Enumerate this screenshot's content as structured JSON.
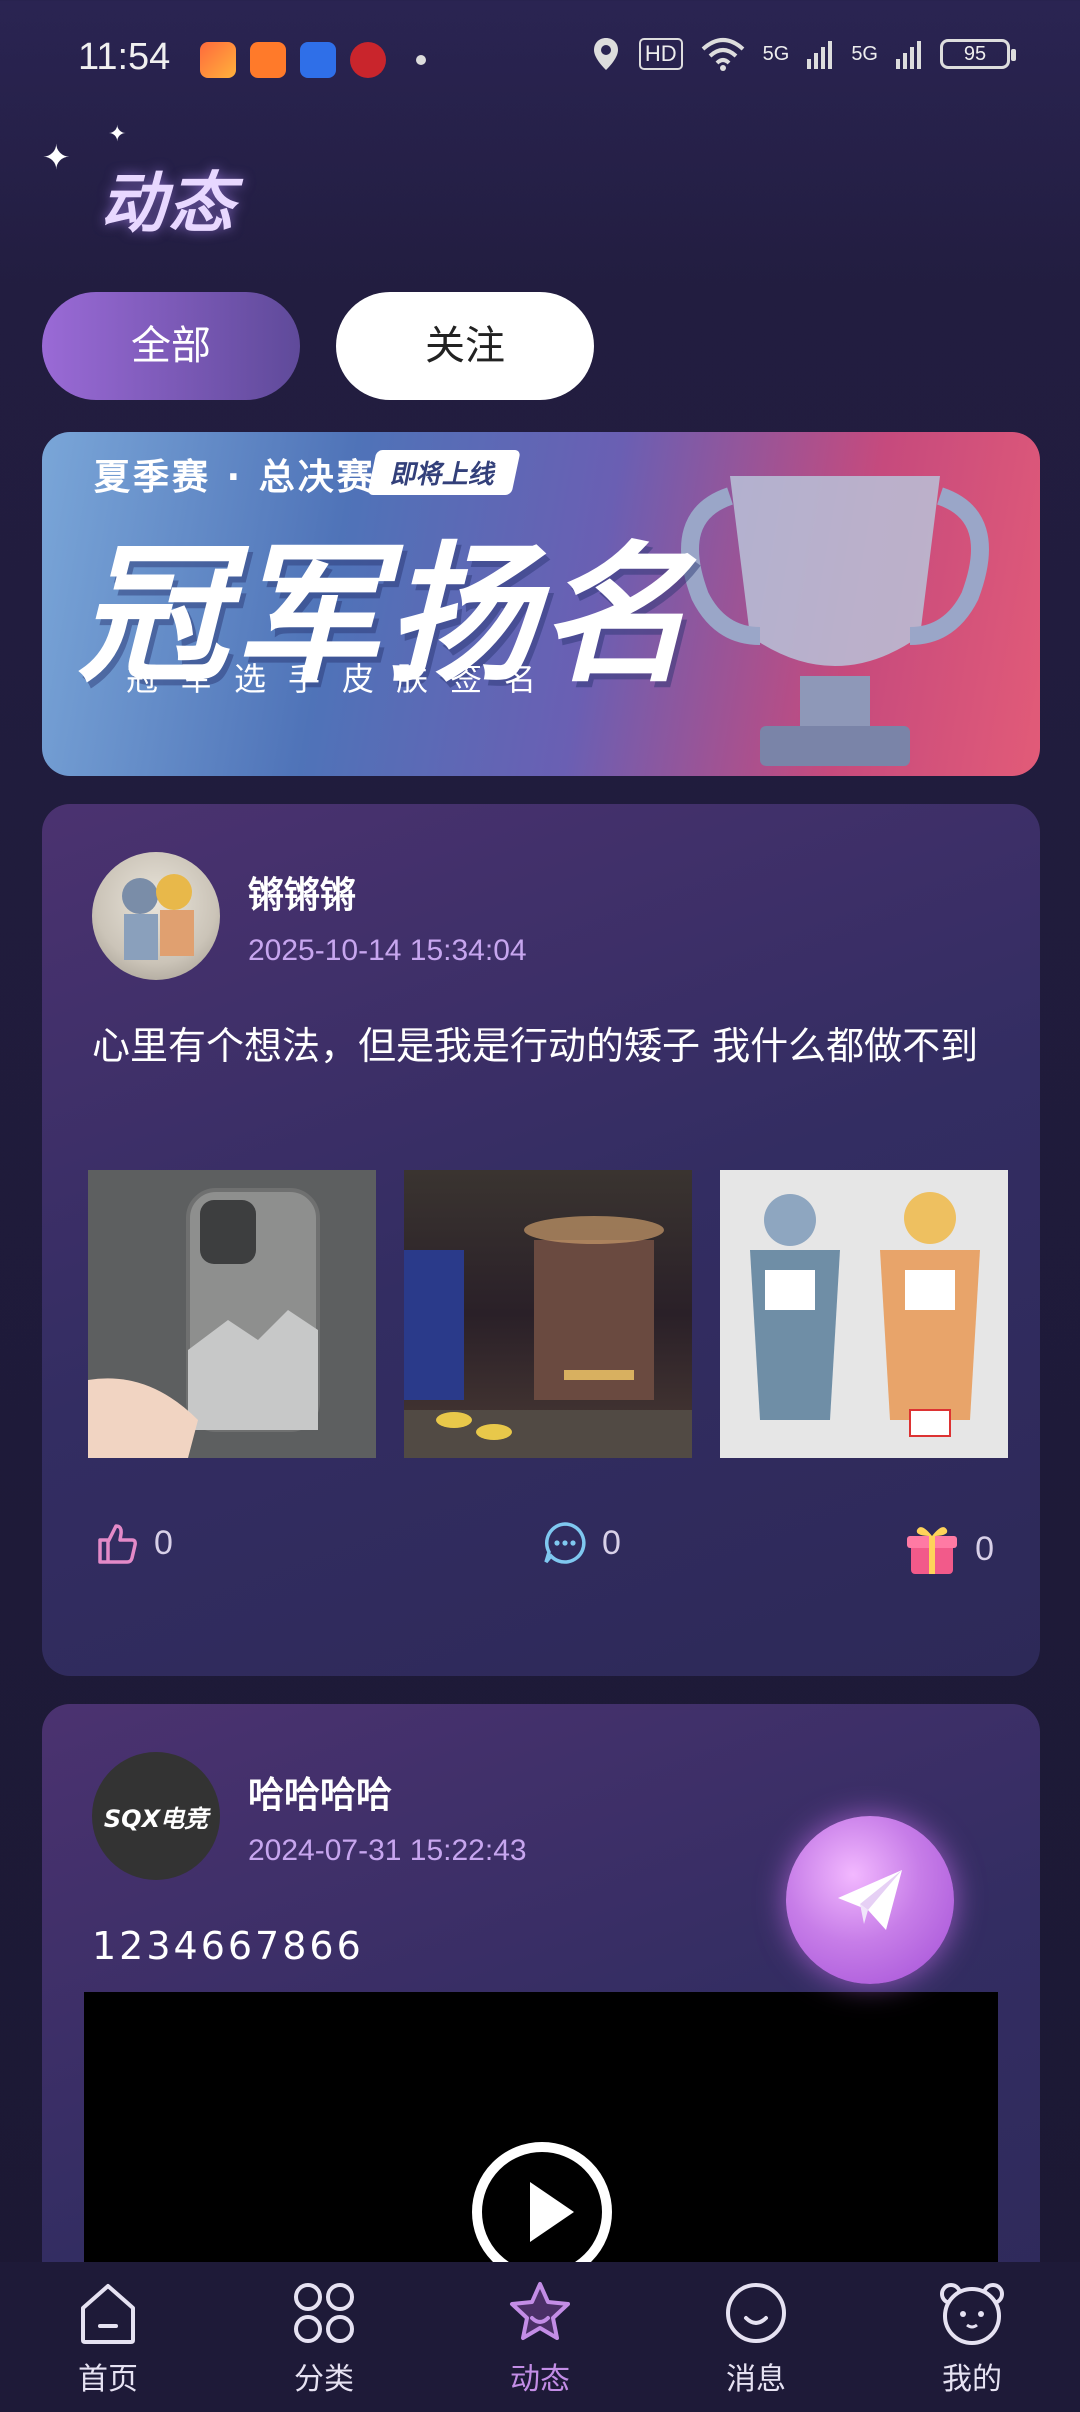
{
  "status_bar": {
    "time": "11:54",
    "hd_label": "HD",
    "net1": "5G",
    "net2": "5G",
    "battery": "95"
  },
  "page": {
    "title": "动态"
  },
  "tabs": [
    {
      "label": "全部",
      "active": true
    },
    {
      "label": "关注",
      "active": false
    }
  ],
  "banner": {
    "subtitle": "夏季赛 · 总决赛",
    "tag": "即将上线",
    "main": "冠军扬名",
    "bottom": "冠军选手皮肤签名"
  },
  "posts": [
    {
      "username": "锵锵锵",
      "datetime": "2025-10-14 15:34:04",
      "text": "心里有个想法，但是我是行动的矮子 我什么都做不到",
      "likes": "0",
      "comments": "0",
      "gifts": "0"
    },
    {
      "username": "哈哈哈哈",
      "avatar_text": "SQX电竞",
      "datetime": "2024-07-31 15:22:43",
      "text": "1234667866"
    }
  ],
  "nav": [
    {
      "label": "首页",
      "icon": "home-icon"
    },
    {
      "label": "分类",
      "icon": "grid-icon"
    },
    {
      "label": "动态",
      "icon": "star-icon",
      "active": true
    },
    {
      "label": "消息",
      "icon": "message-icon"
    },
    {
      "label": "我的",
      "icon": "bear-icon"
    }
  ],
  "colors": {
    "accent": "#c38de6",
    "date": "#c7a6ef",
    "background": "#1b1833"
  }
}
